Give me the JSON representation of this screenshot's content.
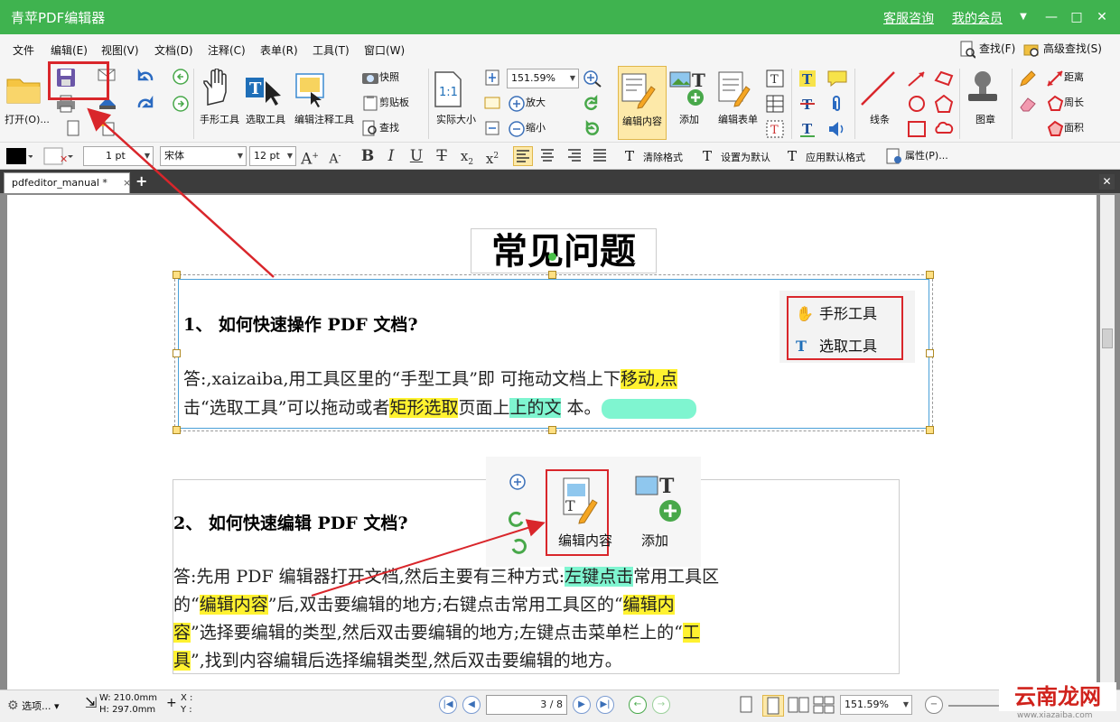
{
  "window": {
    "title": "青苹PDF编辑器",
    "links": [
      "客服咨询",
      "我的会员"
    ],
    "controls": [
      "▼",
      "—",
      "□",
      "✕"
    ]
  },
  "menu": {
    "items": [
      "文件",
      "编辑(E)",
      "视图(V)",
      "文档(D)",
      "注释(C)",
      "表单(R)",
      "工具(T)",
      "窗口(W)"
    ],
    "find": "查找(F)",
    "advanced_find": "高级查找(S)"
  },
  "ribbon": {
    "open": "打开(O)...",
    "hand_tool": "手形工具",
    "select_tool": "选取工具",
    "edit_annotation": "编辑注释工具",
    "snapshot": "快照",
    "clipboard": "剪贴板",
    "find": "查找",
    "actual_size": "实际大小",
    "zoom_value": "151.59%",
    "zoom_in": "放大",
    "zoom_out": "缩小",
    "edit_content": "编辑内容",
    "add": "添加",
    "edit_form": "编辑表单",
    "line": "线条",
    "stamp": "图章",
    "distance": "距离",
    "perimeter": "周长",
    "area": "面积"
  },
  "format": {
    "line_width": "1 pt",
    "font": "宋体",
    "font_size": "12 pt",
    "clear_format": "清除格式",
    "set_default": "设置为默认",
    "apply_default": "应用默认格式",
    "properties": "属性(P)..."
  },
  "tab": {
    "name": "pdfeditor_manual *",
    "close": "×"
  },
  "document": {
    "title": "常见问题",
    "q1": "1、 如何快速操作 PDF 文档?",
    "a1_line1_pre": "答:,xaizaiba,用工具区里的“手型工具”即 可拖动文档上下",
    "a1_line1_hl": "移动,点",
    "a1_line2_pre": "击“选取工具”可以拖动或者",
    "a1_line2_hl": "矩形选取",
    "a1_line2_mid": "页面上",
    "a1_line2_hl2": "上的文",
    "a1_line2_end": " 本。",
    "callout1_hand": "手形工具",
    "callout1_select": "选取工具",
    "q2": "2、 如何快速编辑 PDF 文档?",
    "a2_l1_pre": "答:先用 PDF 编辑器打开文档,然后主要有三种方式:",
    "a2_l1_hl": "左键点击",
    "a2_l1_end": "常用工具区",
    "a2_l2_a": "的“",
    "a2_l2_hl": "编辑内容",
    "a2_l2_b": "”后,双击要编辑的地方;右键点击常用工具区的“",
    "a2_l2_hl2": "编辑内",
    "a2_l3_hl": "容",
    "a2_l3_b": "”选择要编辑的类型,然后双击要编辑的地方;左键点击菜单栏上的“",
    "a2_l3_hl2": "工",
    "a2_l4_hl": "具",
    "a2_l4_b": "”,找到内容编辑后选择编辑类型,然后双击要编辑的地方。",
    "callout2_edit": "编辑内容",
    "callout2_add": "添加"
  },
  "status": {
    "options": "选项...",
    "width": "W: 210.0mm",
    "height": "H: 297.0mm",
    "x": "X :",
    "y": "Y :",
    "page": "3 / 8",
    "zoom": "151.59%"
  },
  "watermark": {
    "brand": "云南龙网",
    "url": "www.xiazaiba.com"
  },
  "colors": {
    "titlebar": "#3fb34f",
    "highlight_yellow": "#fff230",
    "highlight_green": "#7ff5d0",
    "callout_red": "#d9262b"
  }
}
